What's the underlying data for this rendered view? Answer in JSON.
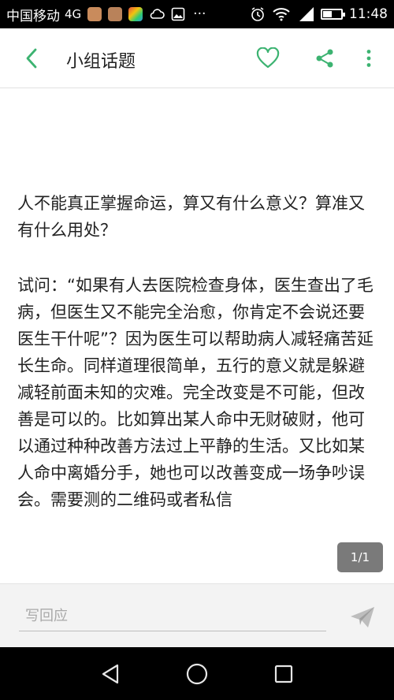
{
  "status_bar": {
    "carrier": "中国移动",
    "network": "4G",
    "more": "···",
    "time": "11:48"
  },
  "header": {
    "title": "小组话题"
  },
  "post": {
    "heading": "人不能真正掌握命运，算又有什么意义？算准又有什么用处？",
    "body": "试问：“如果有人去医院检查身体，医生查出了毛病，但医生又不能完全治愈，你肯定不会说还要医生干什呢”？因为医生可以帮助病人减轻痛苦延长生命。同样道理很简单，五行的意义就是躲避减轻前面未知的灾难。完全改变是不可能，但改善是可以的。比如算出某人命中无财破财，他可以通过种种改善方法过上平静的生活。又比如某人命中离婚分手，她也可以改善变成一场争吵误会。需要测的二维码或者私信"
  },
  "page_indicator": "1/1",
  "reply": {
    "placeholder": "写回应"
  },
  "colors": {
    "accent": "#3cb371",
    "status_bar_bg": "#000000",
    "nav_bar_bg": "#000000",
    "page_indicator_bg": "#7a7a7a"
  },
  "icons": {
    "back": "chevron-left-icon",
    "favorite": "heart-icon",
    "share": "share-icon",
    "more": "more-vertical-icon",
    "send": "paper-plane-icon"
  }
}
